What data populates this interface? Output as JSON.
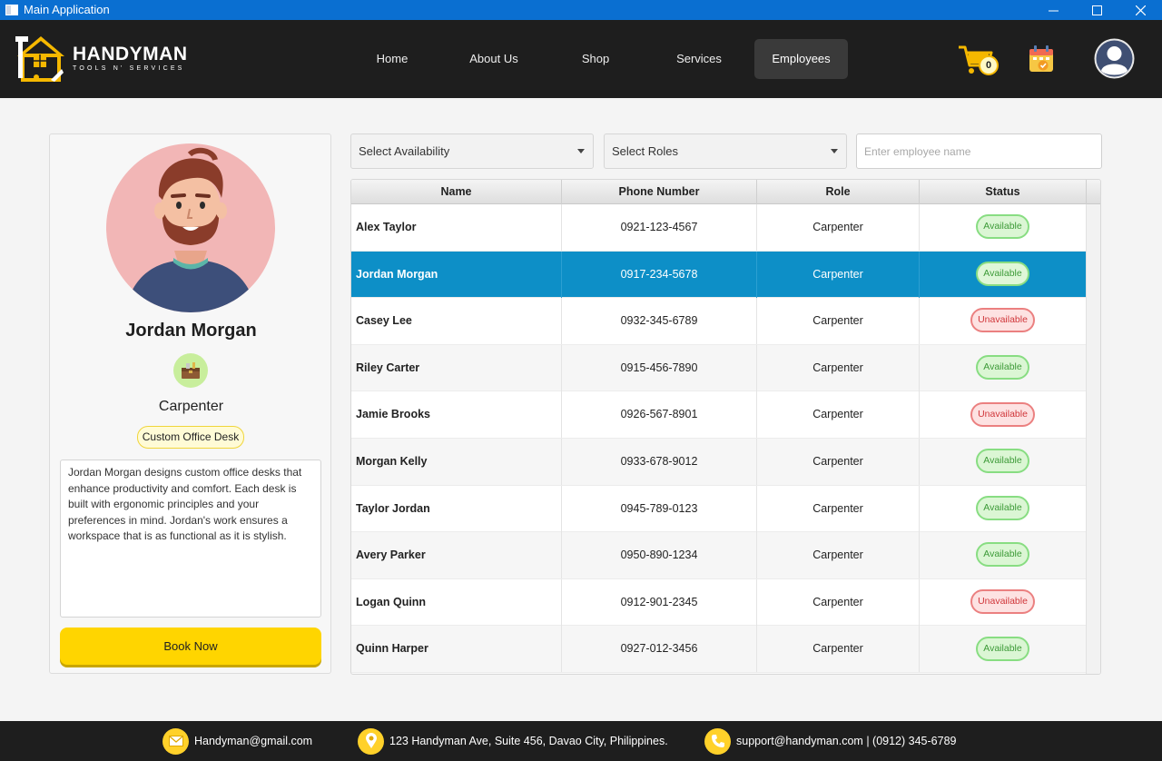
{
  "window": {
    "title": "Main Application"
  },
  "brand": {
    "name": "HANDYMAN",
    "tagline": "TOOLS N' SERVICES"
  },
  "nav": {
    "items": [
      {
        "label": "Home"
      },
      {
        "label": "About Us"
      },
      {
        "label": "Shop"
      },
      {
        "label": "Services"
      },
      {
        "label": "Employees",
        "active": true
      }
    ],
    "cart_count": "0",
    "icons": [
      "cart-icon",
      "calendar-icon",
      "user-avatar-icon"
    ]
  },
  "profile": {
    "name": "Jordan Morgan",
    "role": "Carpenter",
    "specialty": "Custom Office Desk",
    "description": "Jordan Morgan designs custom office desks that enhance productivity and comfort. Each desk is built with ergonomic principles and your preferences in mind. Jordan's work ensures a workspace that is as functional as it is stylish.",
    "book_label": "Book Now"
  },
  "filters": {
    "availability": "Select Availability",
    "roles": "Select Roles",
    "search_placeholder": "Enter employee name"
  },
  "table": {
    "headers": [
      "Name",
      "Phone Number",
      "Role",
      "Status"
    ],
    "rows": [
      {
        "name": "Alex Taylor",
        "phone": "0921-123-4567",
        "role": "Carpenter",
        "status": "Available"
      },
      {
        "name": "Jordan Morgan",
        "phone": "0917-234-5678",
        "role": "Carpenter",
        "status": "Available",
        "selected": true
      },
      {
        "name": "Casey Lee",
        "phone": "0932-345-6789",
        "role": "Carpenter",
        "status": "Unavailable"
      },
      {
        "name": "Riley Carter",
        "phone": "0915-456-7890",
        "role": "Carpenter",
        "status": "Available"
      },
      {
        "name": "Jamie Brooks",
        "phone": "0926-567-8901",
        "role": "Carpenter",
        "status": "Unavailable"
      },
      {
        "name": "Morgan Kelly",
        "phone": "0933-678-9012",
        "role": "Carpenter",
        "status": "Available"
      },
      {
        "name": "Taylor Jordan",
        "phone": "0945-789-0123",
        "role": "Carpenter",
        "status": "Available"
      },
      {
        "name": "Avery Parker",
        "phone": "0950-890-1234",
        "role": "Carpenter",
        "status": "Available"
      },
      {
        "name": "Logan Quinn",
        "phone": "0912-901-2345",
        "role": "Carpenter",
        "status": "Unavailable"
      },
      {
        "name": "Quinn Harper",
        "phone": "0927-012-3456",
        "role": "Carpenter",
        "status": "Available"
      }
    ]
  },
  "footer": {
    "email": "Handyman@gmail.com",
    "address": "123 Handyman Ave, Suite 456, Davao City, Philippines.",
    "support": "support@handyman.com | (0912) 345-6789"
  },
  "colors": {
    "titlebar": "#0a6fd1",
    "navbar": "#1e1e1e",
    "accent": "#ffd500",
    "selected_row": "#0d8fc7",
    "available": "#3c9a37",
    "unavailable": "#d0363a"
  }
}
